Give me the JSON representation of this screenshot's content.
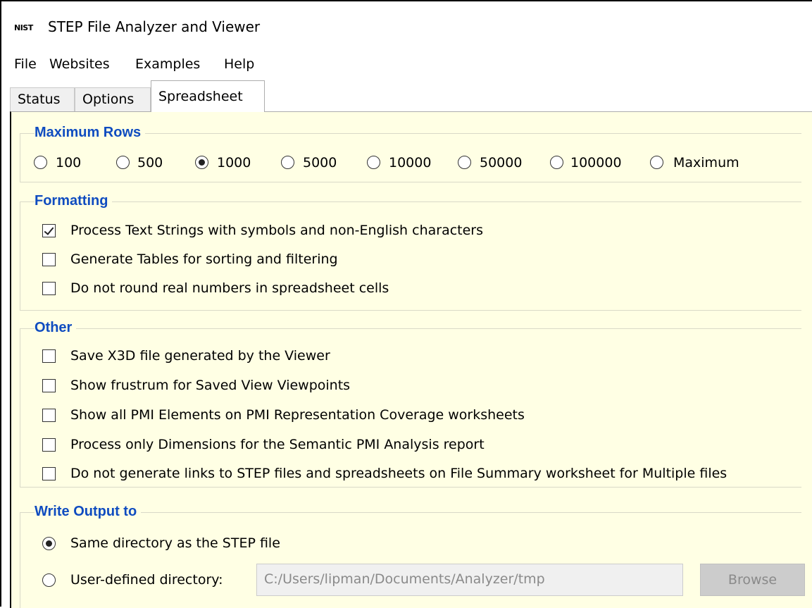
{
  "window": {
    "app_icon": "NIST",
    "title": "STEP File Analyzer and Viewer"
  },
  "menu": [
    "File",
    "Websites",
    "Examples",
    "Help"
  ],
  "tabs": [
    "Status",
    "Options",
    "Spreadsheet"
  ],
  "active_tab": "Spreadsheet",
  "max_rows": {
    "title": "Maximum Rows",
    "options": [
      "100",
      "500",
      "1000",
      "5000",
      "10000",
      "50000",
      "100000",
      "Maximum"
    ],
    "selected": "1000"
  },
  "formatting": {
    "title": "Formatting",
    "items": [
      {
        "label": "Process Text Strings with symbols and non-English characters",
        "checked": true
      },
      {
        "label": "Generate Tables for sorting and filtering",
        "checked": false
      },
      {
        "label": "Do not round real numbers in spreadsheet cells",
        "checked": false
      }
    ]
  },
  "other": {
    "title": "Other",
    "items": [
      {
        "label": "Save X3D file generated by the Viewer",
        "checked": false
      },
      {
        "label": "Show frustrum for Saved View Viewpoints",
        "checked": false
      },
      {
        "label": "Show all PMI Elements on PMI Representation Coverage worksheets",
        "checked": false
      },
      {
        "label": "Process only Dimensions for the Semantic PMI Analysis report",
        "checked": false
      },
      {
        "label": "Do not generate links to STEP files and spreadsheets on File Summary worksheet for Multiple files",
        "checked": false
      }
    ]
  },
  "output": {
    "title": "Write Output to",
    "same_dir_label": "Same directory as the STEP file",
    "user_dir_label": "User-defined directory:",
    "selected": "same",
    "path_value": "C:/Users/lipman/Documents/Analyzer/tmp",
    "browse_label": "Browse"
  }
}
